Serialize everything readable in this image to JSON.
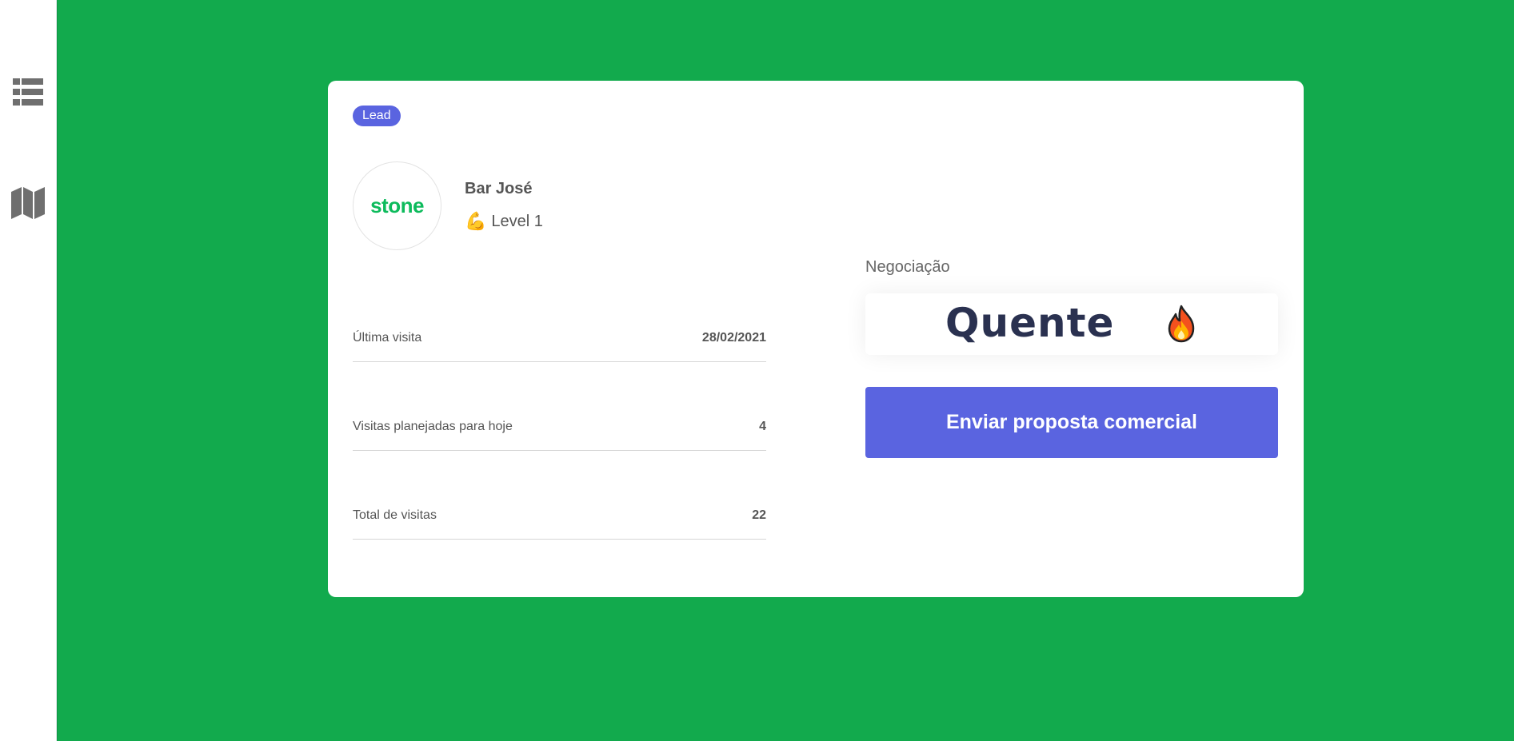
{
  "sidebar": {
    "items": [
      {
        "icon": "list-icon"
      },
      {
        "icon": "map-icon"
      }
    ]
  },
  "card": {
    "badge": "Lead",
    "logo_text": "stone",
    "merchant_name": "Bar José",
    "level_emoji": "💪",
    "level_label": "Level 1",
    "stats": [
      {
        "label": "Última visita",
        "value": "28/02/2021"
      },
      {
        "label": "Visitas planejadas para hoje",
        "value": "4"
      },
      {
        "label": "Total de visitas",
        "value": "22"
      }
    ],
    "negotiation_label": "Negociação",
    "negotiation_value": "Quente",
    "negotiation_icon": "fire-icon",
    "cta_label": "Enviar proposta comercial"
  },
  "colors": {
    "background": "#12aa4d",
    "accent": "#5a64e0",
    "logo": "#0dbb5c",
    "negotiation_text": "#2a3150"
  }
}
